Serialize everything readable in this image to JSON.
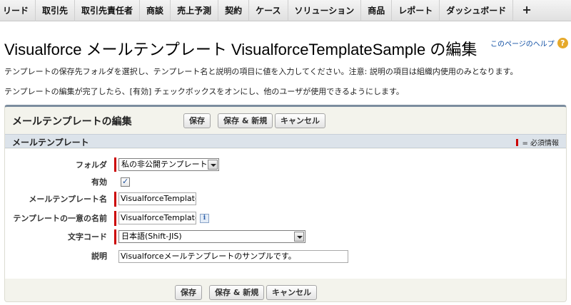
{
  "nav": {
    "tabs": [
      "リード",
      "取引先",
      "取引先責任者",
      "商談",
      "売上予測",
      "契約",
      "ケース",
      "ソリューション",
      "商品",
      "レポート",
      "ダッシュボード"
    ],
    "plus": "+"
  },
  "page": {
    "title": "Visualforce メールテンプレート VisualforceTemplateSample の編集",
    "help_link": "このページのヘルプ",
    "help_icon": "?",
    "description_line1": "テンプレートの保存先フォルダを選択し、テンプレート名と説明の項目に値を入力してください。注意: 説明の項目は組織内使用のみとなります。",
    "description_line2": "テンプレートの編集が完了したら、[有効] チェックボックスをオンにし、他のユーザが使用できるようにします。"
  },
  "panel": {
    "title": "メールテンプレートの編集",
    "save_label": "保存",
    "save_new_label": "保存 & 新規",
    "cancel_label": "キャンセル"
  },
  "section": {
    "title": "メールテンプレート",
    "required_legend": "= 必須情報"
  },
  "form": {
    "folder_label": "フォルダ",
    "folder_value": "私の非公開テンプレート",
    "active_label": "有効",
    "active_checked": true,
    "template_name_label": "メールテンプレート名",
    "template_name_value": "VisualforceTemplateSample",
    "unique_name_label": "テンプレートの一意の名前",
    "unique_name_value": "VisualforceTemplateSample",
    "info_icon": "i",
    "encoding_label": "文字コード",
    "encoding_value": "日本語(Shift-JIS)",
    "description_label": "説明",
    "description_value": "Visualforceメールテンプレートのサンプルです。"
  },
  "colors": {
    "required": "#cc0000",
    "section_bar": "#dce3ea",
    "panel_bg": "#f3f3ec",
    "link": "#0f4ea3",
    "help_icon": "#e6a92a"
  }
}
